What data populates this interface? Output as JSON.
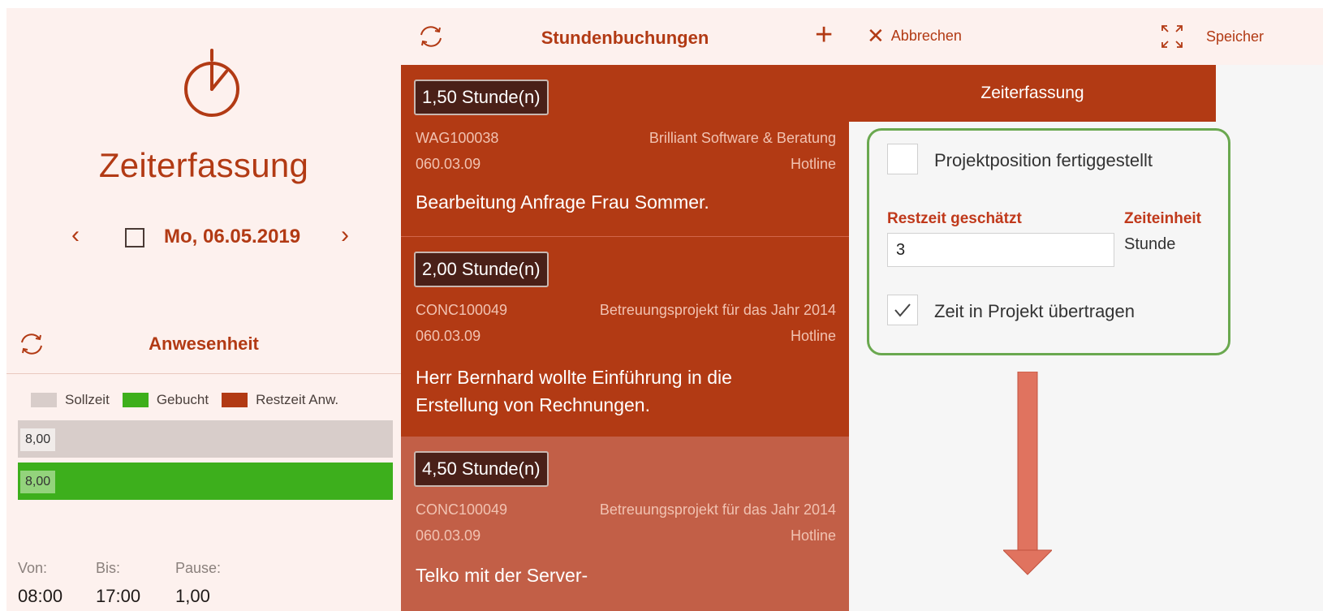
{
  "left": {
    "app_title": "Zeiterfassung",
    "date": "Mo, 06.05.2019",
    "prev_icon": "chevron-left",
    "next_icon": "chevron-right",
    "presence": {
      "title": "Anwesenheit",
      "legend": [
        {
          "label": "Sollzeit",
          "color": "#d8cdca"
        },
        {
          "label": "Gebucht",
          "color": "#3daf1c"
        },
        {
          "label": "Restzeit Anw.",
          "color": "#b23a14"
        }
      ],
      "bars": [
        {
          "value_label": "8,00",
          "color": "#d8cdca",
          "fill_fraction": 1.0
        },
        {
          "value_label": "8,00",
          "color": "#3daf1c",
          "fill_fraction": 1.0
        }
      ],
      "labels": {
        "from": "Von:",
        "to": "Bis:",
        "pause": "Pause:"
      },
      "values": {
        "from": "08:00",
        "to": "17:00",
        "pause": "1,00"
      }
    }
  },
  "middle": {
    "title": "Stundenbuchungen",
    "entries": [
      {
        "hours": "1,50 Stunde(n)",
        "code": "WAG100038",
        "customer": "Brilliant Software & Beratung",
        "position": "060.03.09",
        "activity": "Hotline",
        "description": "Bearbeitung Anfrage Frau Sommer.",
        "selected": false
      },
      {
        "hours": "2,00 Stunde(n)",
        "code": "CONC100049",
        "customer": "Betreuungsprojekt für das Jahr 2014",
        "position": "060.03.09",
        "activity": "Hotline",
        "description": "Herr Bernhard wollte Einführung in die Erstellung von Rechnungen.",
        "selected": false
      },
      {
        "hours": "4,50 Stunde(n)",
        "code": "CONC100049",
        "customer": "Betreuungsprojekt für das Jahr 2014",
        "position": "060.03.09",
        "activity": "Hotline",
        "description": "Telko mit der Server-",
        "selected": true
      }
    ]
  },
  "right": {
    "cancel_label": "Abbrechen",
    "save_label": "Speicher",
    "banner": "Zeiterfassung",
    "form": {
      "completed_label": "Projektposition fertiggestellt",
      "completed_checked": false,
      "remaining_label": "Restzeit geschätzt",
      "remaining_value": "3",
      "unit_label": "Zeiteinheit",
      "unit_value": "Stunde",
      "transfer_label": "Zeit in Projekt übertragen",
      "transfer_checked": true
    }
  },
  "colors": {
    "accent": "#b23a14",
    "panel_bg": "#fdf1ee",
    "entry_bg": "#b23a14",
    "entry_selected_bg": "#c25f47",
    "highlight_border": "#6aa84f",
    "arrow": "#e0735f"
  }
}
